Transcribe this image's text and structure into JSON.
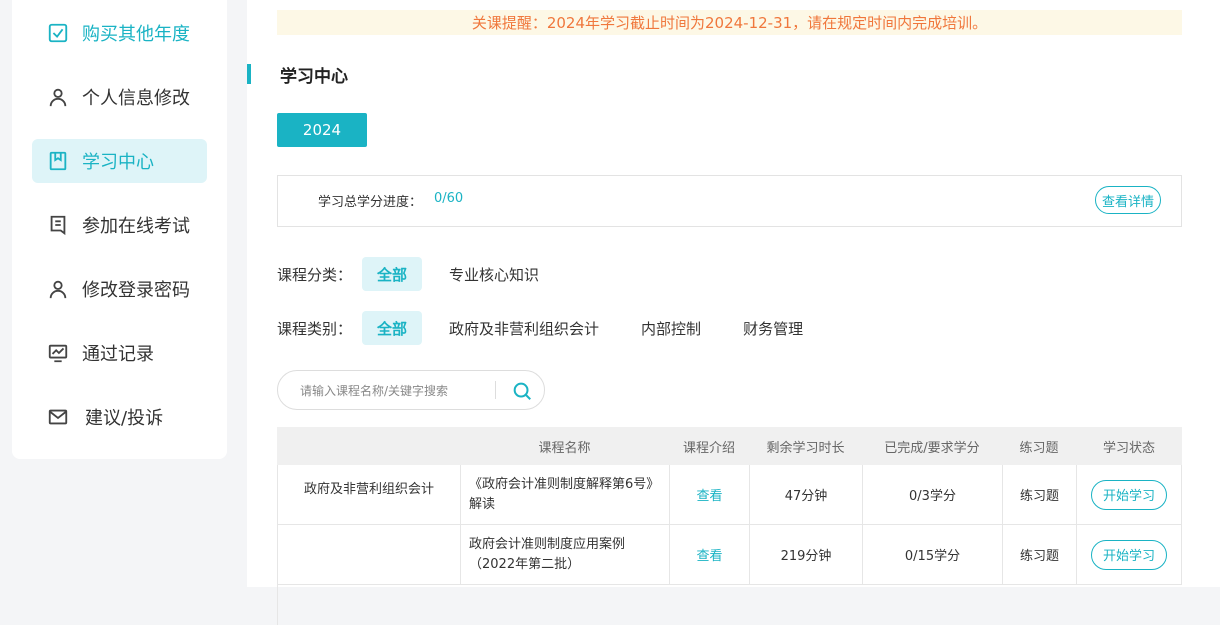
{
  "sidebar": {
    "items": [
      {
        "label": "购买其他年度",
        "icon": "checkbox-icon"
      },
      {
        "label": "个人信息修改",
        "icon": "user-icon"
      },
      {
        "label": "学习中心",
        "icon": "bookmark-icon"
      },
      {
        "label": "参加在线考试",
        "icon": "document-icon"
      },
      {
        "label": "修改登录密码",
        "icon": "user-icon"
      },
      {
        "label": "通过记录",
        "icon": "chart-icon"
      },
      {
        "label": "建议/投诉",
        "icon": "mail-icon"
      }
    ]
  },
  "notice": "关课提醒：2024年学习截止时间为2024-12-31，请在规定时间内完成培训。",
  "page_title": "学习中心",
  "year_tab": "2024",
  "progress": {
    "label": "学习总学分进度：",
    "value": "0/60",
    "detail_button": "查看详情"
  },
  "filters": {
    "category": {
      "label": "课程分类：",
      "options": [
        "全部",
        "专业核心知识"
      ]
    },
    "type": {
      "label": "课程类别：",
      "options": [
        "全部",
        "政府及非营利组织会计",
        "内部控制",
        "财务管理"
      ]
    }
  },
  "search": {
    "placeholder": "请输入课程名称/关键字搜索"
  },
  "table": {
    "headers": [
      "课程名称",
      "课程介绍",
      "剩余学习时长",
      "已完成/要求学分",
      "练习题",
      "学习状态"
    ],
    "group": "政府及非营利组织会计",
    "rows": [
      {
        "name": "《政府会计准则制度解释第6号》解读",
        "intro": "查看",
        "remaining": "47分钟",
        "credits": "0/3学分",
        "exercise": "练习题",
        "status": "开始学习"
      },
      {
        "name": "政府会计准则制度应用案例（2022年第二批）",
        "intro": "查看",
        "remaining": "219分钟",
        "credits": "0/15学分",
        "exercise": "练习题",
        "status": "开始学习"
      }
    ]
  },
  "colors": {
    "accent": "#1ab3c4",
    "accent_light": "#def4f8",
    "notice_text": "#f0773c",
    "notice_bg": "#fdf8e6"
  }
}
